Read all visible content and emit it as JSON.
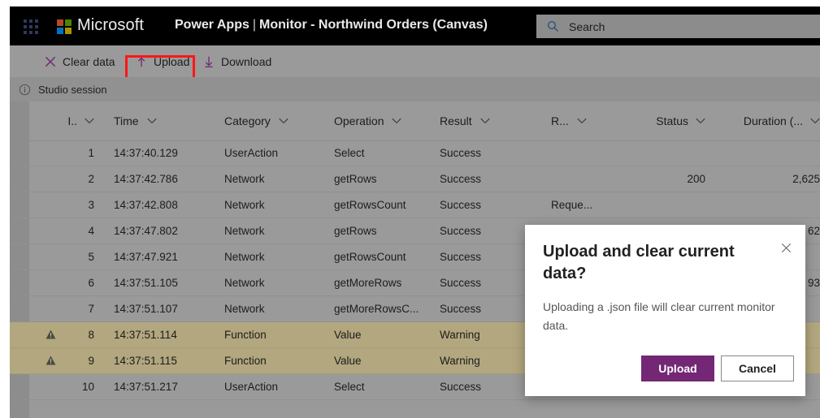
{
  "suite_bar": {
    "waffle_label": "App launcher",
    "brand": "Microsoft",
    "app_name": "Power Apps",
    "separator": "|",
    "page_title": "Monitor - Northwind Orders (Canvas)",
    "search_placeholder": "Search"
  },
  "toolbar": {
    "clear_data": "Clear data",
    "upload": "Upload",
    "download": "Download"
  },
  "info_strip": {
    "label": "Studio session"
  },
  "table": {
    "columns": [
      {
        "key": "index",
        "label": "I..",
        "align": "right"
      },
      {
        "key": "time",
        "label": "Time",
        "align": "left"
      },
      {
        "key": "category",
        "label": "Category",
        "align": "left"
      },
      {
        "key": "operation",
        "label": "Operation",
        "align": "left"
      },
      {
        "key": "result",
        "label": "Result",
        "align": "left"
      },
      {
        "key": "r",
        "label": "R...",
        "align": "left"
      },
      {
        "key": "status",
        "label": "Status",
        "align": "right"
      },
      {
        "key": "duration",
        "label": "Duration (...",
        "align": "right"
      }
    ],
    "rows": [
      {
        "index": "1",
        "time": "14:37:40.129",
        "category": "UserAction",
        "operation": "Select",
        "result": "Success",
        "r": "",
        "status": "",
        "duration": "",
        "warning": false
      },
      {
        "index": "2",
        "time": "14:37:42.786",
        "category": "Network",
        "operation": "getRows",
        "result": "Success",
        "r": "",
        "status": "200",
        "duration": "2,625",
        "warning": false
      },
      {
        "index": "3",
        "time": "14:37:42.808",
        "category": "Network",
        "operation": "getRowsCount",
        "result": "Success",
        "r": "Reque...",
        "status": "",
        "duration": "",
        "warning": false
      },
      {
        "index": "4",
        "time": "14:37:47.802",
        "category": "Network",
        "operation": "getRows",
        "result": "Success",
        "r": "",
        "status": "",
        "duration": "62",
        "warning": false
      },
      {
        "index": "5",
        "time": "14:37:47.921",
        "category": "Network",
        "operation": "getRowsCount",
        "result": "Success",
        "r": "",
        "status": "",
        "duration": "",
        "warning": false
      },
      {
        "index": "6",
        "time": "14:37:51.105",
        "category": "Network",
        "operation": "getMoreRows",
        "result": "Success",
        "r": "",
        "status": "",
        "duration": "93",
        "warning": false
      },
      {
        "index": "7",
        "time": "14:37:51.107",
        "category": "Network",
        "operation": "getMoreRowsC...",
        "result": "Success",
        "r": "",
        "status": "",
        "duration": "",
        "warning": false
      },
      {
        "index": "8",
        "time": "14:37:51.114",
        "category": "Function",
        "operation": "Value",
        "result": "Warning",
        "r": "",
        "status": "",
        "duration": "",
        "warning": true
      },
      {
        "index": "9",
        "time": "14:37:51.115",
        "category": "Function",
        "operation": "Value",
        "result": "Warning",
        "r": "",
        "status": "",
        "duration": "",
        "warning": true
      },
      {
        "index": "10",
        "time": "14:37:51.217",
        "category": "UserAction",
        "operation": "Select",
        "result": "Success",
        "r": "",
        "status": "",
        "duration": "",
        "warning": false
      }
    ]
  },
  "dialog": {
    "title": "Upload and clear current data?",
    "body": "Uploading a .json file will clear current monitor data.",
    "primary_button": "Upload",
    "secondary_button": "Cancel",
    "close_label": "Close"
  },
  "colors": {
    "suite_bar_bg": "#000000",
    "app_bg": "#9a9a9a",
    "gutter_bg": "#8d8d8d",
    "warning_row_bg": "#b2a77f",
    "primary_button_bg": "#742774",
    "highlight_box": "#fc1717",
    "icon_purple": "#742774"
  }
}
